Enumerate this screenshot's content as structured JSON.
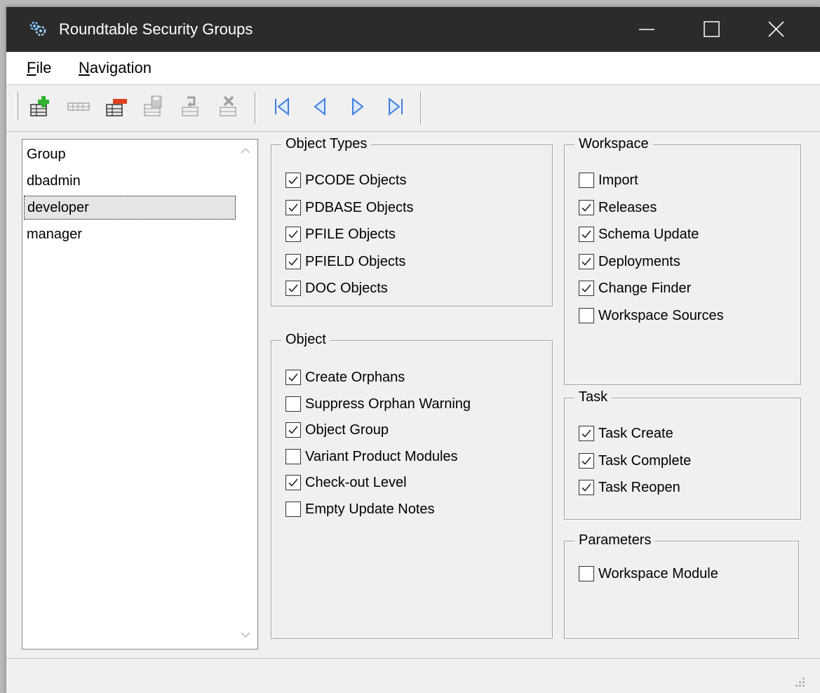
{
  "window": {
    "title": "Roundtable Security Groups"
  },
  "menu": {
    "items": [
      {
        "label": "File",
        "accel": "F",
        "rest": "ile"
      },
      {
        "label": "Navigation",
        "accel": "N",
        "rest": "avigation"
      }
    ]
  },
  "toolbar": {
    "buttons": [
      "add-icon",
      "rename-icon",
      "delete-icon",
      "save-icon",
      "undo-icon",
      "cancel-icon"
    ],
    "nav": [
      "first-record-icon",
      "previous-record-icon",
      "next-record-icon",
      "last-record-icon"
    ]
  },
  "groups": {
    "items": [
      "Group",
      "dbadmin",
      "developer",
      "manager"
    ],
    "selected": "developer"
  },
  "object_types": {
    "title": "Object Types",
    "options": [
      {
        "label": "PCODE Objects",
        "checked": true
      },
      {
        "label": "PDBASE Objects",
        "checked": true
      },
      {
        "label": "PFILE Objects",
        "checked": true
      },
      {
        "label": "PFIELD Objects",
        "checked": true
      },
      {
        "label": "DOC Objects",
        "checked": true
      }
    ]
  },
  "object": {
    "title": "Object",
    "options": [
      {
        "label": "Create Orphans",
        "checked": true
      },
      {
        "label": "Suppress Orphan Warning",
        "checked": false
      },
      {
        "label": "Object Group",
        "checked": true
      },
      {
        "label": "Variant Product Modules",
        "checked": false
      },
      {
        "label": "Check-out Level",
        "checked": true
      },
      {
        "label": "Empty Update Notes",
        "checked": false
      }
    ]
  },
  "workspace": {
    "title": "Workspace",
    "options": [
      {
        "label": "Import",
        "checked": false
      },
      {
        "label": "Releases",
        "checked": true
      },
      {
        "label": "Schema Update",
        "checked": true
      },
      {
        "label": "Deployments",
        "checked": true
      },
      {
        "label": "Change Finder",
        "checked": true
      },
      {
        "label": "Workspace Sources",
        "checked": false
      }
    ]
  },
  "task": {
    "title": "Task",
    "options": [
      {
        "label": "Task Create",
        "checked": true
      },
      {
        "label": "Task Complete",
        "checked": true
      },
      {
        "label": "Task Reopen",
        "checked": true
      }
    ]
  },
  "parameters": {
    "title": "Parameters",
    "options": [
      {
        "label": "Workspace Module",
        "checked": false
      }
    ]
  },
  "colors": {
    "titlebar": "#2b2b2b",
    "nav_arrow": "#3d7fe0",
    "add_green": "#2fb52f",
    "delete_red": "#e0401e"
  }
}
